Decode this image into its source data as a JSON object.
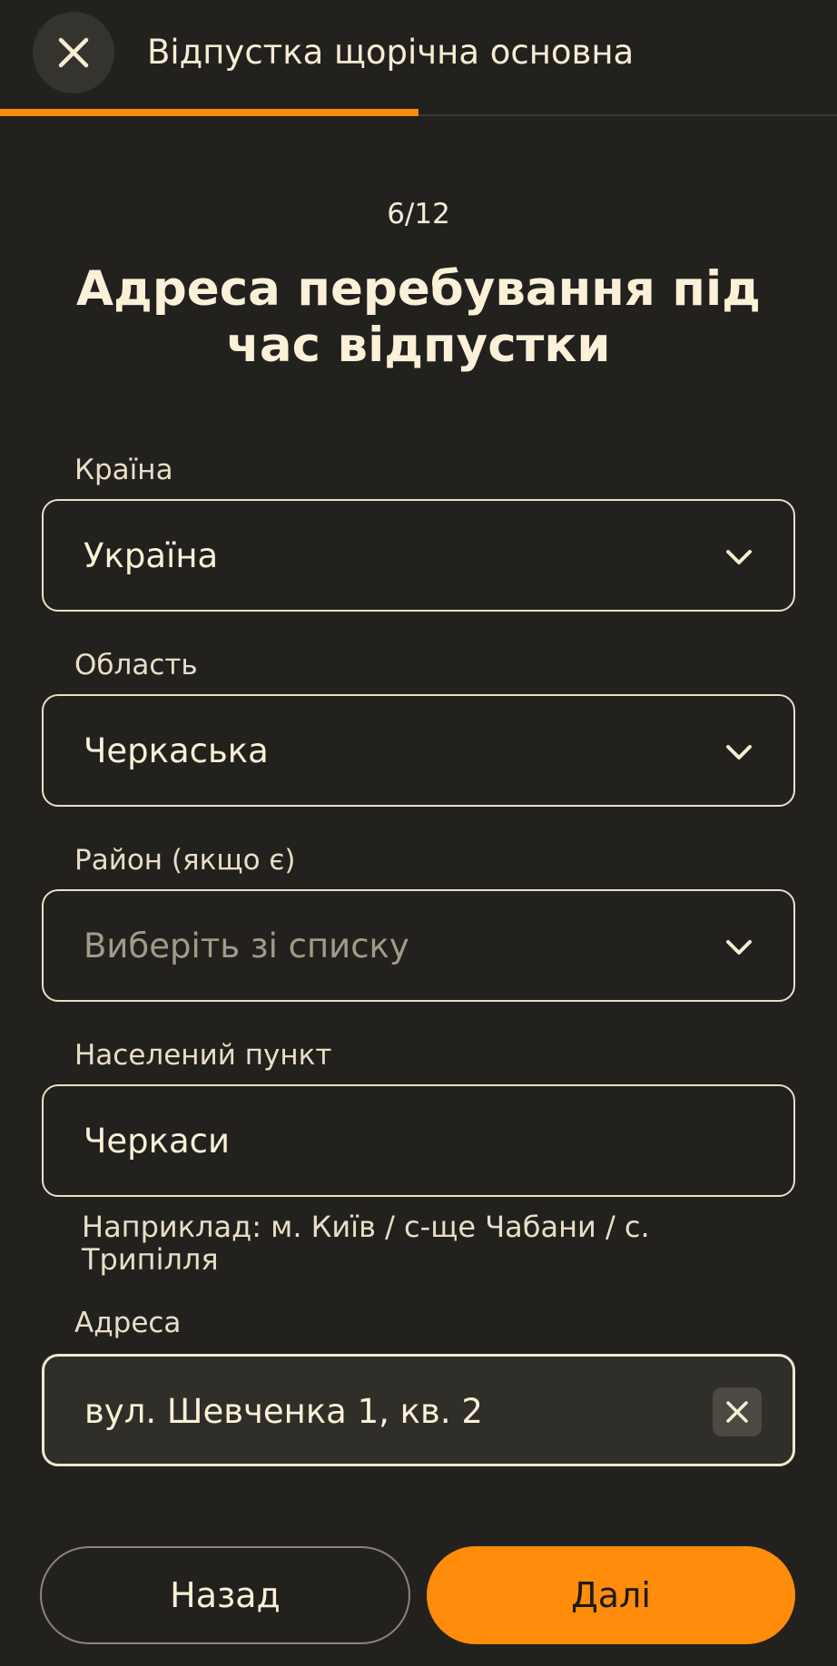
{
  "header": {
    "title": "Відпустка щорічна основна",
    "close_icon": "close-icon"
  },
  "progress": {
    "current": 6,
    "total": 12,
    "fraction": 0.5,
    "color": "#ff8c0a"
  },
  "step_label": "6/12",
  "page_title": "Адреса перебування під час відпустки",
  "fields": {
    "country": {
      "label": "Країна",
      "value": "Україна"
    },
    "region": {
      "label": "Область",
      "value": "Черкаська"
    },
    "district": {
      "label": "Район (якщо є)",
      "placeholder": "Виберіть зі списку"
    },
    "settlement": {
      "label": "Населений пункт",
      "value": "Черкаси",
      "hint": "Наприклад: м. Київ / с-ще Чабани / с. Трипілля"
    },
    "address": {
      "label": "Адреса",
      "value": "вул. Шевченка 1, кв. 2"
    }
  },
  "buttons": {
    "back": "Назад",
    "next": "Далі"
  },
  "colors": {
    "background": "#22211e",
    "accent": "#ff8c0a",
    "text": "#f7ecd4"
  }
}
